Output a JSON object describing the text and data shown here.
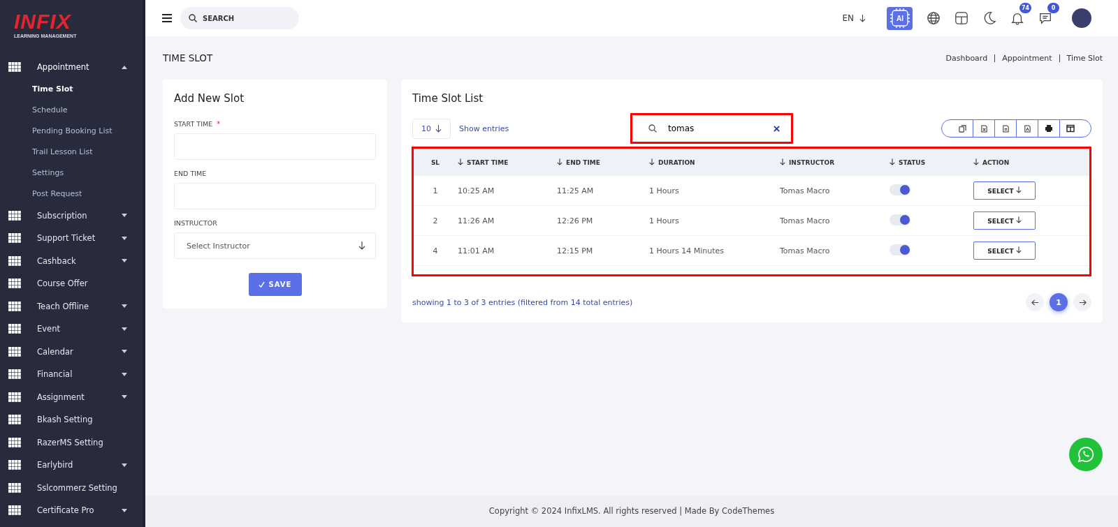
{
  "logo": {
    "brand": "INFIX",
    "tagline": "LEARNING MANAGEMENT"
  },
  "sidebar": {
    "items": [
      {
        "label": "Appointment",
        "expandable": true,
        "expanded": true,
        "children": [
          {
            "label": "Time Slot",
            "selected": true
          },
          {
            "label": "Schedule",
            "selected": false
          },
          {
            "label": "Pending Booking List",
            "selected": false
          },
          {
            "label": "Trail Lesson List",
            "selected": false
          },
          {
            "label": "Settings",
            "selected": false
          },
          {
            "label": "Post Request",
            "selected": false
          }
        ]
      },
      {
        "label": "Subscription",
        "expandable": true,
        "expanded": false
      },
      {
        "label": "Support Ticket",
        "expandable": true,
        "expanded": false
      },
      {
        "label": "Cashback",
        "expandable": true,
        "expanded": false
      },
      {
        "label": "Course Offer",
        "expandable": false,
        "expanded": false
      },
      {
        "label": "Teach Offline",
        "expandable": true,
        "expanded": false
      },
      {
        "label": "Event",
        "expandable": true,
        "expanded": false
      },
      {
        "label": "Calendar",
        "expandable": true,
        "expanded": false
      },
      {
        "label": "Financial",
        "expandable": true,
        "expanded": false
      },
      {
        "label": "Assignment",
        "expandable": true,
        "expanded": false
      },
      {
        "label": "Bkash Setting",
        "expandable": false,
        "expanded": false
      },
      {
        "label": "RazerMS Setting",
        "expandable": false,
        "expanded": false
      },
      {
        "label": "Earlybird",
        "expandable": true,
        "expanded": false
      },
      {
        "label": "Sslcommerz Setting",
        "expandable": false,
        "expanded": false
      },
      {
        "label": "Certificate Pro",
        "expandable": true,
        "expanded": false
      }
    ]
  },
  "topbar": {
    "search_placeholder": "SEARCH",
    "language": "EN",
    "ai_label": "AI",
    "notifications": "74",
    "messages": "0"
  },
  "page": {
    "title": "TIME SLOT",
    "breadcrumb": [
      "Dashboard",
      "Appointment",
      "Time Slot"
    ]
  },
  "form": {
    "title": "Add New Slot",
    "fields": [
      {
        "kind": "text",
        "label": "START TIME",
        "required": true
      },
      {
        "kind": "text",
        "label": "END TIME",
        "required": false
      },
      {
        "kind": "select",
        "label": "INSTRUCTOR",
        "required": false,
        "placeholder": "Select Instructor"
      }
    ],
    "required_mark": "*",
    "save": "SAVE"
  },
  "list": {
    "title": "Time Slot List",
    "page_size": "10",
    "show_entries": "Show entries",
    "search_value": "tomas",
    "columns": [
      "SL",
      "START TIME",
      "END TIME",
      "DURATION",
      "INSTRUCTOR",
      "STATUS",
      "ACTION"
    ],
    "rows": [
      {
        "sl": "1",
        "start": "10:25 AM",
        "end": "11:25 AM",
        "duration": "1 Hours",
        "instructor": "Tomas Macro",
        "status": true,
        "action": "SELECT"
      },
      {
        "sl": "2",
        "start": "11:26 AM",
        "end": "12:26 PM",
        "duration": "1 Hours",
        "instructor": "Tomas Macro",
        "status": true,
        "action": "SELECT"
      },
      {
        "sl": "4",
        "start": "11:01 AM",
        "end": "12:15 PM",
        "duration": "1 Hours 14 Minutes",
        "instructor": "Tomas Macro",
        "status": true,
        "action": "SELECT"
      }
    ],
    "summary": "showing 1 to 3 of 3 entries (filtered from 14 total entries)",
    "pages": [
      {
        "label": "1",
        "selected": true
      }
    ]
  },
  "footer": "Copyright © 2024 InfixLMS. All rights reserved | Made By CodeThemes"
}
